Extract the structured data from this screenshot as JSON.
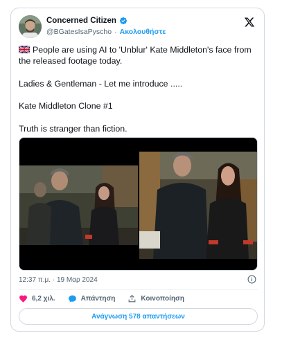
{
  "author": {
    "display_name": "Concerned Citizen",
    "handle": "@BGatesIsaPyscho",
    "separator": "·",
    "follow_label": "Ακολουθήστε"
  },
  "tweet": {
    "line1": "People are using AI to 'Unblur' Kate Middleton's face from the released footage today.",
    "line2": "Ladies & Gentleman - Let me introduce .....",
    "line3": "Kate Middleton Clone #1",
    "line4": "Truth is stranger than fiction."
  },
  "meta": {
    "time": "12:37 π.μ.",
    "separator": "·",
    "date": "19 Μαρ 2024"
  },
  "actions": {
    "likes": "6,2 χιλ.",
    "reply_label": "Απάντηση",
    "share_label": "Κοινοποίηση"
  },
  "replies_button": "Ανάγνωση 578 απαντήσεων",
  "icons": {
    "verified": "verified-badge-icon",
    "x_logo": "x-logo-icon",
    "flag": "uk-flag-icon",
    "info": "info-icon",
    "heart": "heart-icon",
    "reply": "reply-bubble-icon",
    "share": "share-upload-icon"
  },
  "colors": {
    "accent": "#1d9bf0",
    "heart": "#f91880",
    "text": "#0f1419",
    "muted": "#536471"
  }
}
